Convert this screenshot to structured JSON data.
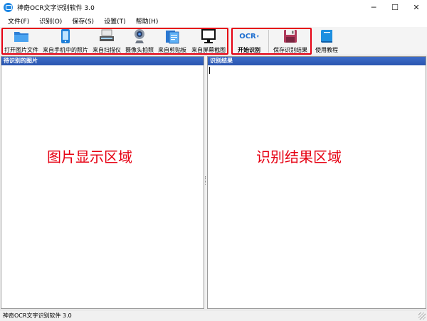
{
  "window": {
    "title": "神奇OCR文字识别软件 3.0",
    "minimize": "─",
    "maximize": "☐",
    "close": "✕"
  },
  "menu": [
    {
      "label": "文件(F)"
    },
    {
      "label": "识别(O)"
    },
    {
      "label": "保存(S)"
    },
    {
      "label": "设置(T)"
    },
    {
      "label": "帮助(H)"
    }
  ],
  "toolbar": {
    "open_file": "打开图片文件",
    "from_phone": "来自手机中的照片",
    "from_scanner": "来自扫描仪",
    "from_camera": "摄像头拍照",
    "from_clipboard": "来自剪贴板",
    "screenshot": "来自屏幕截图",
    "ocr_icon_text": "OCR",
    "start_ocr": "开始识别",
    "save_result": "保存识别结果",
    "tutorial": "使用教程"
  },
  "panels": {
    "left_header": "待识别的图片",
    "left_overlay": "图片显示区域",
    "right_header": "识别结果",
    "right_overlay": "识别结果区域"
  },
  "status": {
    "text": "神奇OCR文字识别软件 3.0"
  },
  "colors": {
    "highlight_border": "#e60012",
    "panel_header": "#2a56b0",
    "overlay_text": "#e60012"
  }
}
